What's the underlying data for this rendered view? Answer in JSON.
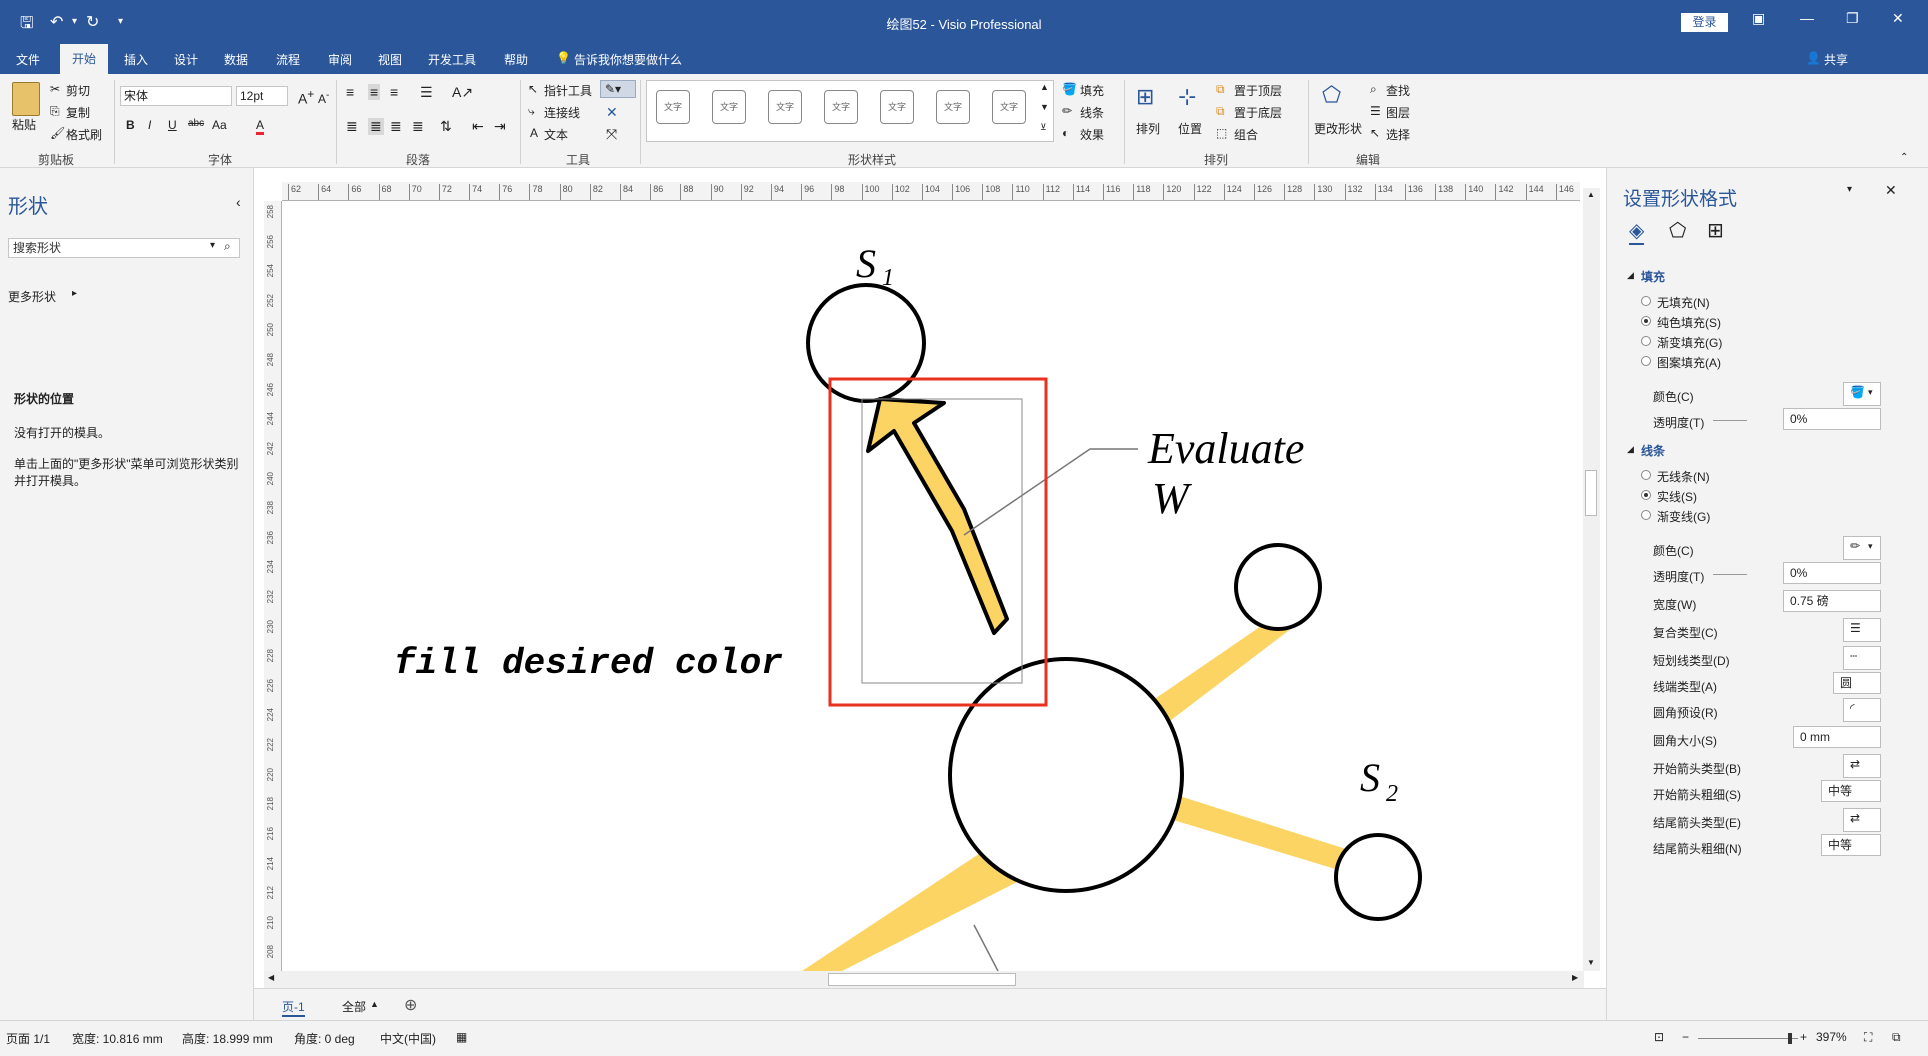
{
  "window": {
    "title": "绘图52 - Visio Professional",
    "login": "登录",
    "share": "共享"
  },
  "menu": {
    "tabs": [
      "文件",
      "开始",
      "插入",
      "设计",
      "数据",
      "流程",
      "审阅",
      "视图",
      "开发工具",
      "帮助"
    ],
    "active": "开始",
    "tell_me": "告诉我你想要做什么"
  },
  "ribbon": {
    "clipboard": {
      "paste": "粘贴",
      "cut": "剪切",
      "copy": "复制",
      "format_painter": "格式刷",
      "group": "剪贴板"
    },
    "font": {
      "name": "宋体",
      "size": "12pt",
      "group": "字体",
      "bold": "B",
      "italic": "I",
      "underline": "U",
      "strike": "abc",
      "case": "Aa",
      "color": "A"
    },
    "paragraph": {
      "group": "段落"
    },
    "tools": {
      "pointer": "指针工具",
      "connector": "连接线",
      "text": "文本",
      "group": "工具"
    },
    "shape_styles": {
      "swatch_label": "文字",
      "fill": "填充",
      "line": "线条",
      "effect": "效果",
      "group": "形状样式"
    },
    "arrange": {
      "arrange": "排列",
      "position": "位置",
      "bring_front": "置于顶层",
      "send_back": "置于底层",
      "group_btn": "组合",
      "group": "排列"
    },
    "editing": {
      "change_shape": "更改形状",
      "find": "查找",
      "layers": "图层",
      "select": "选择",
      "group": "编辑"
    }
  },
  "left_panel": {
    "title": "形状",
    "search_placeholder": "搜索形状",
    "more_shapes": "更多形状",
    "section_title": "形状的位置",
    "msg1": "没有打开的模具。",
    "msg2": "单击上面的\"更多形状\"菜单可浏览形状类别并打开模具。"
  },
  "canvas": {
    "annotation_text": "fill desired color",
    "label_s1": "S",
    "label_s1_sub": "1",
    "label_s2": "S",
    "label_s2_sub": "2",
    "label_evaluate": "Evaluate",
    "label_w": "W",
    "fill_color": "#fcd463",
    "highlight_color": "#e8321e",
    "ruler_top": [
      "62",
      "64",
      "66",
      "68",
      "70",
      "72",
      "74",
      "76",
      "78",
      "80",
      "82",
      "84",
      "86",
      "88",
      "90",
      "92",
      "94",
      "96",
      "98",
      "100",
      "102",
      "104",
      "106",
      "108",
      "110",
      "112",
      "114",
      "116",
      "118",
      "120",
      "122",
      "124",
      "126",
      "128",
      "130",
      "132",
      "134",
      "136",
      "138",
      "140",
      "142",
      "144",
      "146"
    ],
    "ruler_left": [
      "258",
      "256",
      "254",
      "252",
      "250",
      "248",
      "246",
      "244",
      "242",
      "240",
      "238",
      "236",
      "234",
      "232",
      "230",
      "228",
      "226",
      "224",
      "222",
      "220",
      "218",
      "216",
      "214",
      "212",
      "210",
      "208"
    ]
  },
  "page_tabs": {
    "page": "页-1",
    "all": "全部"
  },
  "right_panel": {
    "title": "设置形状格式",
    "fill_section": "填充",
    "fill_options": [
      "无填充(N)",
      "纯色填充(S)",
      "渐变填充(G)",
      "图案填充(A)"
    ],
    "fill_selected": 1,
    "color_label": "颜色(C)",
    "transparency_label": "透明度(T)",
    "fill_transparency": "0%",
    "line_section": "线条",
    "line_options": [
      "无线条(N)",
      "实线(S)",
      "渐变线(G)"
    ],
    "line_selected": 1,
    "line_color_label": "颜色(C)",
    "line_transparency_label": "透明度(T)",
    "line_transparency": "0%",
    "width_label": "宽度(W)",
    "width_value": "0.75 磅",
    "compound_label": "复合类型(C)",
    "dash_label": "短划线类型(D)",
    "cap_label": "线端类型(A)",
    "cap_value": "圆",
    "rounding_label": "圆角预设(R)",
    "rounding_size_label": "圆角大小(S)",
    "rounding_size_value": "0 mm",
    "begin_arrow_type": "开始箭头类型(B)",
    "begin_arrow_size": "开始箭头粗细(S)",
    "begin_arrow_size_value": "中等",
    "end_arrow_type": "结尾箭头类型(E)",
    "end_arrow_size": "结尾箭头粗细(N)",
    "end_arrow_size_value": "中等"
  },
  "status": {
    "page": "页面 1/1",
    "width": "宽度: 10.816 mm",
    "height": "高度: 18.999 mm",
    "angle": "角度: 0 deg",
    "lang": "中文(中国)",
    "zoom": "397%"
  }
}
